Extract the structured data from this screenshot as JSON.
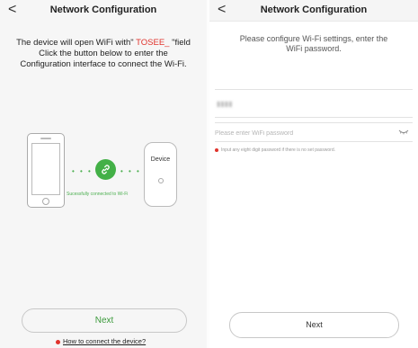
{
  "left": {
    "nav": {
      "back": "<",
      "title": "Network Configuration"
    },
    "instructions": {
      "line1_prefix": "The device will open WiFi with\"",
      "line1_highlight": "TOSEE_",
      "line1_suffix": "\"field",
      "line2": "Click the button below to enter the",
      "line3": "Configuration interface to connect the Wi-Fi."
    },
    "illustration": {
      "dots_left": "• • •",
      "dots_right": "• • •",
      "success_text": "Sucessfully connected to Wi-Fi",
      "device_label": "Device"
    },
    "next_label": "Next",
    "help_link": "How to connect the device?"
  },
  "right": {
    "nav": {
      "back": "<",
      "title": "Network Configuration"
    },
    "instructions": {
      "line1": "Please configure Wi-Fi settings, enter the",
      "line2": "WiFi password."
    },
    "ssid_value": "▮▮▮▮",
    "password_placeholder": "Please enter WiFi password",
    "hint": "Input any eight digit password if there is no set password.",
    "next_label": "Next"
  },
  "colors": {
    "accent_green": "#43b047",
    "highlight_red": "#e0332c"
  }
}
